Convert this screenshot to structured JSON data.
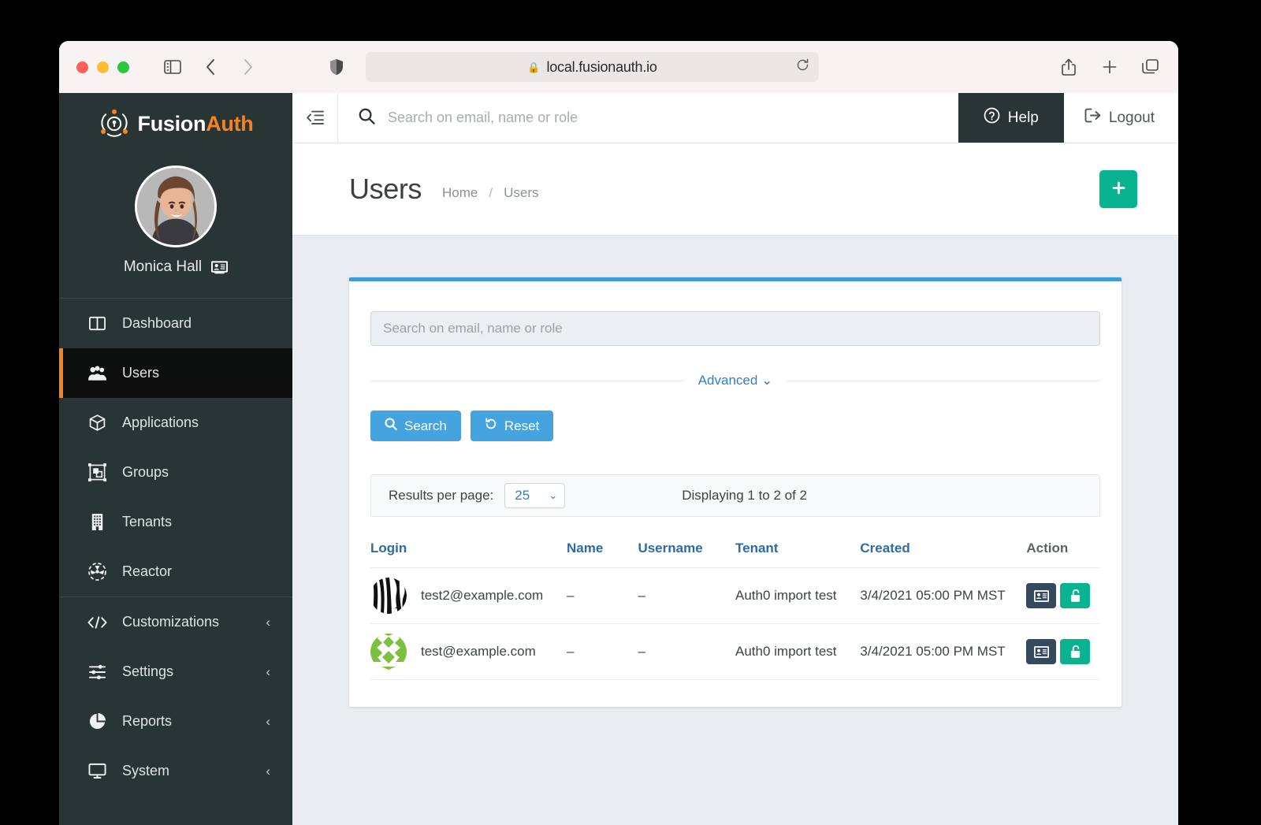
{
  "browser": {
    "url": "local.fusionauth.io",
    "lock_icon": "lock-icon",
    "reload_icon": "reload-icon",
    "sidebar_toggle_icon": "sidebar-toggle-icon",
    "back_icon": "back-arrow-icon",
    "forward_icon": "forward-arrow-icon",
    "shield_icon": "shield-icon",
    "share_icon": "share-icon",
    "newtab_icon": "plus-icon",
    "tabs_icon": "tab-overview-icon"
  },
  "sidebar": {
    "brand": {
      "first": "Fusion",
      "second": "Auth",
      "logo_icon": "fusionauth-logo-icon"
    },
    "profile": {
      "name": "Monica Hall",
      "badge_icon": "id-card-icon",
      "avatar_icon": "user-avatar"
    },
    "items": [
      {
        "label": "Dashboard",
        "icon": "dashboard-icon",
        "active": false,
        "caret": ""
      },
      {
        "label": "Users",
        "icon": "users-icon",
        "active": true,
        "caret": ""
      },
      {
        "label": "Applications",
        "icon": "applications-icon",
        "active": false,
        "caret": ""
      },
      {
        "label": "Groups",
        "icon": "groups-icon",
        "active": false,
        "caret": ""
      },
      {
        "label": "Tenants",
        "icon": "tenants-icon",
        "active": false,
        "caret": ""
      },
      {
        "label": "Reactor",
        "icon": "reactor-icon",
        "active": false,
        "caret": ""
      },
      {
        "label": "Customizations",
        "icon": "code-icon",
        "active": false,
        "caret": "‹"
      },
      {
        "label": "Settings",
        "icon": "sliders-icon",
        "active": false,
        "caret": "‹"
      },
      {
        "label": "Reports",
        "icon": "pie-chart-icon",
        "active": false,
        "caret": "‹"
      },
      {
        "label": "System",
        "icon": "monitor-icon",
        "active": false,
        "caret": "‹"
      }
    ]
  },
  "topbar": {
    "collapse_icon": "collapse-sidebar-icon",
    "search_placeholder": "Search on email, name or role",
    "search_value": "",
    "search_icon": "search-icon",
    "help_label": "Help",
    "help_icon": "question-circle-icon",
    "logout_label": "Logout",
    "logout_icon": "logout-icon"
  },
  "page": {
    "title": "Users",
    "breadcrumbs": [
      "Home",
      "/",
      "Users"
    ],
    "add_button_label": "+",
    "add_button_icon": "plus-icon"
  },
  "search_card": {
    "input_placeholder": "Search on email, name or role",
    "input_value": "",
    "advanced_label": "Advanced",
    "advanced_caret_icon": "chevron-down-icon",
    "search_button": {
      "label": "Search",
      "icon": "search-icon"
    },
    "reset_button": {
      "label": "Reset",
      "icon": "reset-icon"
    }
  },
  "results_bar": {
    "label": "Results per page:",
    "selected": "25",
    "chevron_icon": "chevron-down-icon",
    "displaying": "Displaying 1 to 2 of 2"
  },
  "table": {
    "columns": [
      "Login",
      "Name",
      "Username",
      "Tenant",
      "Created",
      "Action"
    ],
    "rows": [
      {
        "avatar": "zebra-identicon",
        "login": "test2@example.com",
        "name": "–",
        "username": "–",
        "tenant": "Auth0 import test",
        "created": "3/4/2021 05:00 PM MST",
        "actions": [
          {
            "name": "manage-user-button",
            "icon": "id-card-icon"
          },
          {
            "name": "unlock-user-button",
            "icon": "unlock-icon"
          }
        ]
      },
      {
        "avatar": "green-identicon",
        "login": "test@example.com",
        "name": "–",
        "username": "–",
        "tenant": "Auth0 import test",
        "created": "3/4/2021 05:00 PM MST",
        "actions": [
          {
            "name": "manage-user-button",
            "icon": "id-card-icon"
          },
          {
            "name": "unlock-user-button",
            "icon": "unlock-icon"
          }
        ]
      }
    ]
  },
  "colors": {
    "sidebar_bg": "#293434",
    "sidebar_active_bg": "#0d0f0f",
    "accent_orange": "#f58320",
    "primary_blue": "#45a3e0",
    "card_top_blue": "#3c9cd7",
    "green": "#0ab390",
    "dark_navy": "#34495e",
    "content_bg": "#e9edf0"
  }
}
